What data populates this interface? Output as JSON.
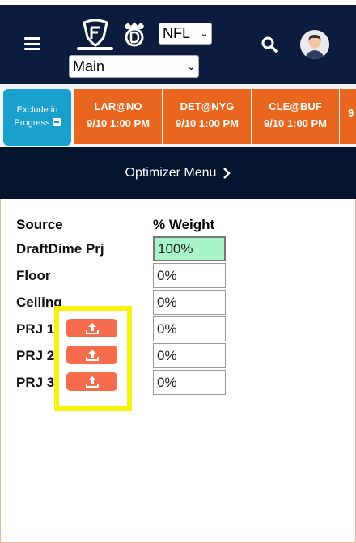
{
  "header": {
    "sport": "NFL",
    "slate": "Main"
  },
  "games_bar": {
    "exclude_line1": "Exclude in",
    "exclude_line2": "Progress",
    "games": [
      {
        "matchup": "LAR@NO",
        "time": "9/10 1:00 PM"
      },
      {
        "matchup": "DET@NYG",
        "time": "9/10 1:00 PM"
      },
      {
        "matchup": "CLE@BUF",
        "time": "9/10 1:00 PM"
      },
      {
        "matchup": "",
        "time": "9"
      }
    ]
  },
  "optimizer_menu": {
    "label": "Optimizer Menu"
  },
  "table": {
    "source_header": "Source",
    "weight_header": "% Weight",
    "rows": [
      {
        "label": "DraftDime Prj",
        "weight": "100%"
      },
      {
        "label": "Floor",
        "weight": "0%"
      },
      {
        "label": "Ceiling",
        "weight": "0%"
      },
      {
        "label": "PRJ 1",
        "weight": "0%"
      },
      {
        "label": "PRJ 2",
        "weight": "0%"
      },
      {
        "label": "PRJ 3",
        "weight": "0%"
      }
    ]
  },
  "colors": {
    "header_bg": "#0c1c3e",
    "game_card": "#e8661d",
    "exclude_card": "#1aa0cc",
    "upload_button": "#f46c4c",
    "active_input": "#a8f4c6",
    "highlight": "#f7f20c"
  },
  "icons": {
    "menu": "hamburger-icon",
    "fanduel": "fanduel-logo-icon",
    "draftkings": "draftkings-logo-icon",
    "search": "search-icon",
    "upload": "upload-icon"
  }
}
